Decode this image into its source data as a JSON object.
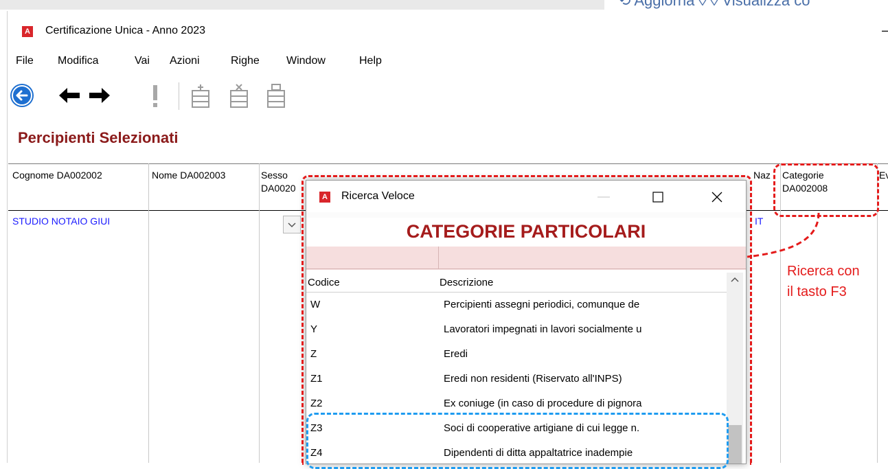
{
  "top_strip_text": "⟲ Aggiorna   ◊ ◊ Visualizza co",
  "window": {
    "app_icon": "A",
    "title": "Certificazione Unica - Anno 2023",
    "minimize_glyph": "–"
  },
  "menu": [
    "File",
    "Modifica",
    "Vai",
    "Azioni",
    "Righe",
    "Window",
    "Help"
  ],
  "toolbar": {
    "icons": [
      "back-circle-icon",
      "arrow-left-icon",
      "arrow-right-icon",
      "exclamation-icon",
      "add-row-icon",
      "delete-row-icon",
      "edit-row-icon"
    ]
  },
  "section_title": "Percipienti Selezionati",
  "grid": {
    "headers": {
      "cognome": "Cognome  DA002002",
      "nome": "Nome  DA002003",
      "sesso_1": "Sesso",
      "sesso_2": "DA0020",
      "naz": "Naz",
      "categorie_1": "Categorie",
      "categorie_2": "DA002008",
      "ev": "Ev"
    },
    "row1": {
      "cognome": "STUDIO NOTAIO GIUI",
      "naz": "IT"
    }
  },
  "dialog": {
    "app_icon": "A",
    "title": "Ricerca Veloce",
    "heading": "CATEGORIE PARTICOLARI",
    "columns": {
      "code": "Codice",
      "description": "Descrizione"
    },
    "rows": [
      {
        "code": "W",
        "description": "Percipienti assegni periodici, comunque de"
      },
      {
        "code": "Y",
        "description": "Lavoratori impegnati in lavori socialmente u"
      },
      {
        "code": "Z",
        "description": "Eredi"
      },
      {
        "code": "Z1",
        "description": "Eredi non residenti (Riservato all'INPS)"
      },
      {
        "code": "Z2",
        "description": "Ex coniuge (in caso di procedure di pignora"
      },
      {
        "code": "Z3",
        "description": "Soci di cooperative artigiane di cui legge n."
      },
      {
        "code": "Z4",
        "description": "Dipendenti di ditta appaltatrice inadempie"
      }
    ]
  },
  "annotation": {
    "line1": "Ricerca con",
    "line2": "il tasto F3"
  },
  "colors": {
    "title_red": "#8b1a1a",
    "heading_red": "#a51c1c",
    "annotation_red": "#e41b1b",
    "annotation_blue": "#1f9cf0",
    "link_blue": "#1b1bff"
  }
}
